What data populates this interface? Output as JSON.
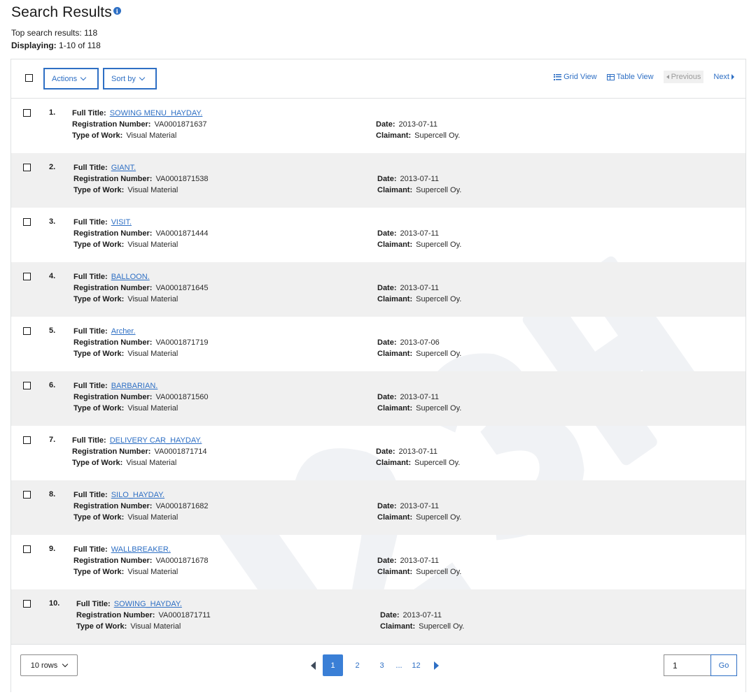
{
  "header": {
    "title": "Search Results",
    "info_icon": "info-icon",
    "top_results_label": "Top search results:",
    "top_results_count": "118",
    "displaying_label": "Displaying:",
    "displaying_value": "1-10 of 118"
  },
  "toolbar": {
    "actions_label": "Actions",
    "sort_label": "Sort by",
    "grid_view_label": "Grid View",
    "table_view_label": "Table View",
    "previous_label": "Previous",
    "next_label": "Next"
  },
  "labels": {
    "full_title": "Full Title:",
    "registration_number": "Registration Number:",
    "type_of_work": "Type of Work:",
    "date": "Date:",
    "claimant": "Claimant:"
  },
  "results": [
    {
      "num": "1.",
      "title": "SOWING MENU_HAYDAY.",
      "reg": "VA0001871637",
      "type": "Visual Material",
      "date": "2013-07-11",
      "claimant": "Supercell Oy."
    },
    {
      "num": "2.",
      "title": "GIANT.",
      "reg": "VA0001871538",
      "type": "Visual Material",
      "date": "2013-07-11",
      "claimant": "Supercell Oy."
    },
    {
      "num": "3.",
      "title": "VISIT.",
      "reg": "VA0001871444",
      "type": "Visual Material",
      "date": "2013-07-11",
      "claimant": "Supercell Oy."
    },
    {
      "num": "4.",
      "title": "BALLOON.",
      "reg": "VA0001871645",
      "type": "Visual Material",
      "date": "2013-07-11",
      "claimant": "Supercell Oy."
    },
    {
      "num": "5.",
      "title": "Archer.",
      "reg": "VA0001871719",
      "type": "Visual Material",
      "date": "2013-07-06",
      "claimant": "Supercell Oy."
    },
    {
      "num": "6.",
      "title": "BARBARIAN.",
      "reg": "VA0001871560",
      "type": "Visual Material",
      "date": "2013-07-11",
      "claimant": "Supercell Oy."
    },
    {
      "num": "7.",
      "title": "DELIVERY CAR_HAYDAY.",
      "reg": "VA0001871714",
      "type": "Visual Material",
      "date": "2013-07-11",
      "claimant": "Supercell Oy."
    },
    {
      "num": "8.",
      "title": "SILO_HAYDAY.",
      "reg": "VA0001871682",
      "type": "Visual Material",
      "date": "2013-07-11",
      "claimant": "Supercell Oy."
    },
    {
      "num": "9.",
      "title": "WALLBREAKER.",
      "reg": "VA0001871678",
      "type": "Visual Material",
      "date": "2013-07-11",
      "claimant": "Supercell Oy."
    },
    {
      "num": "10.",
      "title": "SOWING_HAYDAY.",
      "reg": "VA0001871711",
      "type": "Visual Material",
      "date": "2013-07-11",
      "claimant": "Supercell Oy."
    }
  ],
  "pagination": {
    "rows_label": "10 rows",
    "pages": [
      "1",
      "2",
      "3"
    ],
    "ellipsis": "...",
    "last_page": "12",
    "active_page": "1",
    "goto_value": "1",
    "go_label": "Go"
  },
  "colors": {
    "accent": "#2e6fc4",
    "active_page": "#3a7fd6",
    "row_alt": "#f0f0f0"
  }
}
